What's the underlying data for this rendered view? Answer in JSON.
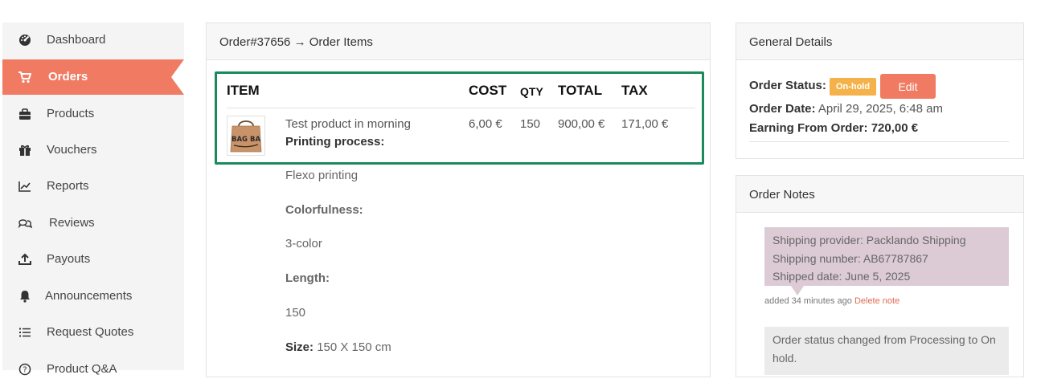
{
  "sidebar": {
    "items": [
      {
        "label": "Dashboard",
        "icon": "dashboard-gauge-icon"
      },
      {
        "label": "Orders",
        "icon": "cart-icon",
        "active": true
      },
      {
        "label": "Products",
        "icon": "briefcase-icon"
      },
      {
        "label": "Vouchers",
        "icon": "gift-icon"
      },
      {
        "label": "Reports",
        "icon": "line-chart-icon"
      },
      {
        "label": "Reviews",
        "icon": "chat-bubbles-icon"
      },
      {
        "label": "Payouts",
        "icon": "upload-icon"
      },
      {
        "label": "Announcements",
        "icon": "bell-icon"
      },
      {
        "label": "Request Quotes",
        "icon": "list-icon"
      },
      {
        "label": "Product Q&A",
        "icon": "question-circle-icon"
      }
    ]
  },
  "order_items": {
    "title": "Order#37656 → Order Items",
    "columns": {
      "item": "ITEM",
      "cost": "COST",
      "qty": "QTY",
      "total": "TOTAL",
      "tax": "TAX"
    },
    "row": {
      "name": "Test product in morning",
      "cost": "6,00 €",
      "qty": "150",
      "total": "900,00 €",
      "tax": "171,00 €"
    },
    "meta": {
      "printing_label": "Printing process:",
      "printing_value": "Flexo printing",
      "color_label": "Colorfulness:",
      "color_value": "3-color",
      "length_label": "Length:",
      "length_value": "150",
      "size_label": "Size:",
      "size_value": "150 X 150 cm"
    },
    "thumbnail_text": "BAG BA"
  },
  "general": {
    "title": "General Details",
    "status_label": "Order Status:",
    "status_badge": "On-hold",
    "edit_label": "Edit",
    "date_label": "Order Date:",
    "date_value": "April 29, 2025, 6:48 am",
    "earning_label": "Earning From Order:",
    "earning_value": "720,00 €"
  },
  "notes": {
    "title": "Order Notes",
    "customer_note": {
      "line1": "Shipping provider: Packlando Shipping",
      "line2": "Shipping number: AB67787867",
      "line3": "Shipped date: June 5, 2025"
    },
    "customer_meta": "added 34 minutes ago",
    "delete_label": "Delete note",
    "system_note": "Order status changed from Processing to On hold."
  },
  "colors": {
    "accent": "#f07b62",
    "badge": "#f6b24a",
    "highlight_border": "#1a8a5a",
    "customer_note_bg": "#dccad5"
  }
}
